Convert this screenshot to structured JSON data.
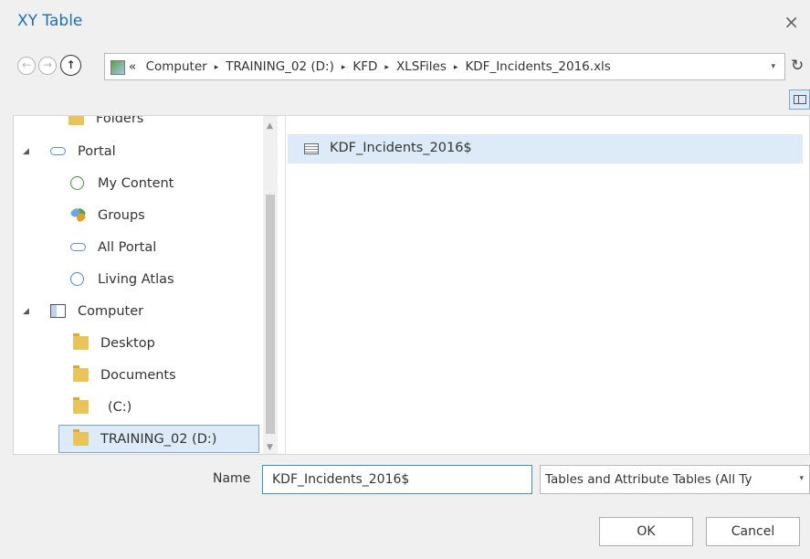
{
  "window": {
    "title": "XY Table",
    "close_glyph": "×"
  },
  "nav": {
    "back_glyph": "←",
    "forward_glyph": "→",
    "up_glyph": "↑",
    "overflow_glyph": "«",
    "breadcrumbs": [
      "Computer",
      "TRAINING_02 (D:)",
      "KFD",
      "XLSFiles",
      "KDF_Incidents_2016.xls"
    ],
    "separator_glyph": "▸",
    "refresh_glyph": "↻"
  },
  "tree": {
    "items": [
      {
        "label": "Folders",
        "icon": "folder-icon"
      },
      {
        "label": "Portal",
        "icon": "cloud-icon"
      },
      {
        "label": "My Content",
        "icon": "my-content-icon"
      },
      {
        "label": "Groups",
        "icon": "groups-icon"
      },
      {
        "label": "All Portal",
        "icon": "cloud-icon"
      },
      {
        "label": "Living Atlas",
        "icon": "living-atlas-icon"
      },
      {
        "label": "Computer",
        "icon": "computer-icon"
      },
      {
        "label": "Desktop",
        "icon": "folder-icon"
      },
      {
        "label": "Documents",
        "icon": "folder-icon"
      },
      {
        "label": "(C:)",
        "icon": "folder-icon"
      },
      {
        "label": "TRAINING_02 (D:)",
        "icon": "folder-icon",
        "selected": true
      }
    ],
    "expander_glyph": "◢"
  },
  "content": {
    "items": [
      {
        "label": "KDF_Incidents_2016$",
        "icon": "table-icon"
      }
    ]
  },
  "footer": {
    "name_label": "Name",
    "name_value": "KDF_Incidents_2016$",
    "filter_value": "Tables and Attribute Tables (All Ty",
    "filter_arrow": "▾",
    "ok_label": "OK",
    "cancel_label": "Cancel"
  }
}
